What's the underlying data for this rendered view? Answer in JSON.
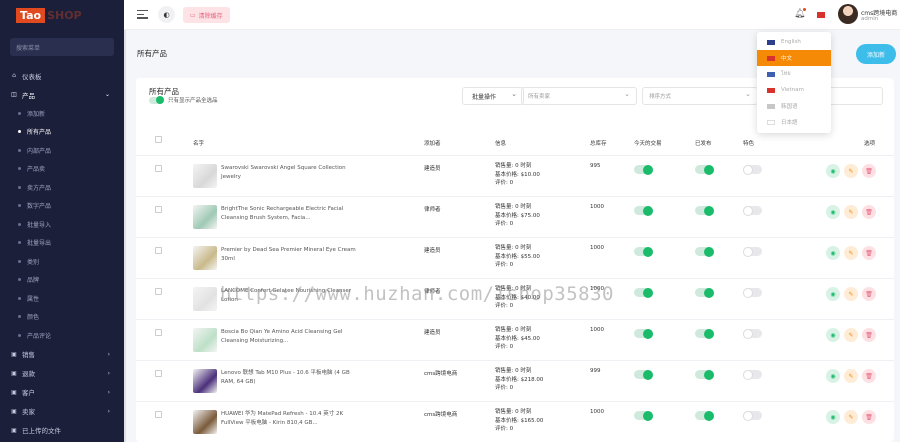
{
  "logo": {
    "text1": "Tao",
    "text2": "SHOP"
  },
  "sidebar": {
    "search_placeholder": "搜索菜单",
    "items": [
      {
        "label": "仪表板",
        "icon": "dashboard-icon"
      },
      {
        "label": "产品",
        "icon": "product-icon",
        "open": true
      }
    ],
    "sub_items": [
      "添加新",
      "所有产品",
      "内部产品",
      "产品卖",
      "卖方产品",
      "数字产品",
      "批量导入",
      "批量导出",
      "类别",
      "品牌",
      "属性",
      "颜色",
      "产品评论"
    ],
    "active_sub": "所有产品",
    "bottom_items": [
      {
        "label": "销售",
        "icon": "cart-icon"
      },
      {
        "label": "退款",
        "icon": "refund-icon"
      },
      {
        "label": "客户",
        "icon": "user-icon"
      },
      {
        "label": "卖家",
        "icon": "seller-icon"
      },
      {
        "label": "已上传的文件",
        "icon": "upload-icon"
      }
    ]
  },
  "header": {
    "clear_cache": "清除缓存",
    "user_name": "cms跨境电商",
    "user_role": "admin"
  },
  "languages": [
    {
      "label": "English",
      "flag": "#2c3e8c",
      "active": false
    },
    {
      "label": "中文",
      "flag": "#d8322c",
      "active": true
    },
    {
      "label": "ไทย",
      "flag": "#3f5fb0",
      "active": false
    },
    {
      "label": "Vietnam",
      "flag": "#d8322c",
      "active": false
    },
    {
      "label": "韩国语",
      "flag": "#c7c7c7",
      "active": false
    },
    {
      "label": "日本語",
      "flag": "#ffffff",
      "active": false
    }
  ],
  "page": {
    "title": "所有产品",
    "add_new": "添加新"
  },
  "card": {
    "title": "所有产品",
    "toggle_label": "只有显示产品全选品",
    "bulk_action": "批量操作",
    "seller_placeholder": "所有卖家",
    "sort_placeholder": "排序方式"
  },
  "table": {
    "headers": [
      "名字",
      "添加者",
      "信息",
      "总库存",
      "今天的交易",
      "已发布",
      "特色",
      "选项"
    ],
    "rows": [
      {
        "name": "Swarovski Swarovski Angel Square Collection Jewelry",
        "vendor": "建造员",
        "num_sales": "销售量: 0 时刻",
        "base_price": "基本价格: $10.00",
        "rating": "评价: 0",
        "stock": "995",
        "today": true,
        "published": true,
        "featured": false,
        "thumb": "#d8d8d8"
      },
      {
        "name": "BrightThe Sonic Rechargeable Electric Facial Cleansing Brush System, Facia...",
        "vendor": "律师者",
        "num_sales": "销售量: 0 时刻",
        "base_price": "基本价格: $75.00",
        "rating": "评价: 0",
        "stock": "1000",
        "today": true,
        "published": true,
        "featured": false,
        "thumb": "#9fc9b4"
      },
      {
        "name": "Premier by Dead Sea Premier Mineral Eye Cream 30ml",
        "vendor": "建造员",
        "num_sales": "销售量: 0 时刻",
        "base_price": "基本价格: $55.00",
        "rating": "评价: 0",
        "stock": "1000",
        "today": true,
        "published": true,
        "featured": false,
        "thumb": "#c9b98a"
      },
      {
        "name": "LANCOME Confort Gelatee Nourishing Cleanser Lotion",
        "vendor": "律师者",
        "num_sales": "销售量: 0 时刻",
        "base_price": "基本价格: $40.00",
        "rating": "评价: 0",
        "stock": "1000",
        "today": true,
        "published": true,
        "featured": false,
        "thumb": "#e2e2e2"
      },
      {
        "name": "Boscia Bo Qian Ye Amino Acid Cleansing Gel Cleansing Moisturizing...",
        "vendor": "建造员",
        "num_sales": "销售量: 0 时刻",
        "base_price": "基本价格: $45.00",
        "rating": "评价: 0",
        "stock": "1000",
        "today": true,
        "published": true,
        "featured": false,
        "thumb": "#bde0c7"
      },
      {
        "name": "Lenovo 联想 Tab M10 Plus - 10.6 平板电脑 (4 GB RAM, 64 GB)",
        "vendor": "cms跨境电商",
        "num_sales": "销售量: 0 时刻",
        "base_price": "基本价格: $218.00",
        "rating": "评价: 0",
        "stock": "999",
        "today": true,
        "published": true,
        "featured": false,
        "thumb": "#4b2f7a"
      },
      {
        "name": "HUAWEI 华为 MatePad Refresh - 10.4 英寸 2K FullView 平板电脑 - Kirin 810,4 GB...",
        "vendor": "cms跨境电商",
        "num_sales": "销售量: 0 时刻",
        "base_price": "基本价格: $165.00",
        "rating": "评价: 0",
        "stock": "1000",
        "today": true,
        "published": true,
        "featured": false,
        "thumb": "#7a5a3a"
      }
    ]
  },
  "watermark": "https://www.huzhan.com/ishop35830"
}
